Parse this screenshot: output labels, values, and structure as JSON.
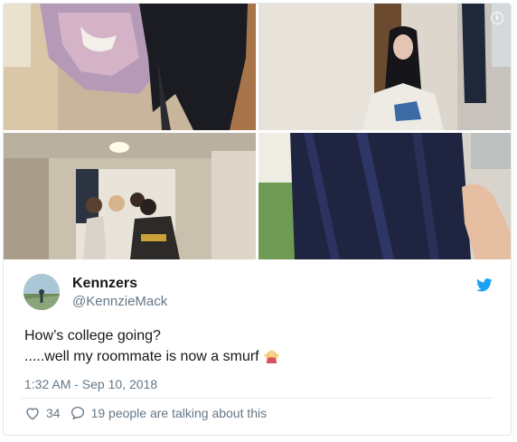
{
  "media": {
    "info_glyph": "i",
    "photos": [
      {
        "name": "photo-1",
        "desc_icon": "photo"
      },
      {
        "name": "photo-2",
        "desc_icon": "photo"
      },
      {
        "name": "photo-3",
        "desc_icon": "photo"
      },
      {
        "name": "photo-4",
        "desc_icon": "photo"
      }
    ]
  },
  "author": {
    "display_name": "Kennzers",
    "screen_name": "@KennzieMack"
  },
  "tweet": {
    "line1": "How’s college going?",
    "line2": ".....well my roommate is now a smurf",
    "timestamp": "1:32 AM - Sep 10, 2018"
  },
  "actions": {
    "likes": "34",
    "replies": "19 people are talking about this"
  },
  "colors": {
    "brand": "#1da1f2",
    "text": "#14171a",
    "muted": "#657786",
    "border": "#e1e8ed"
  }
}
